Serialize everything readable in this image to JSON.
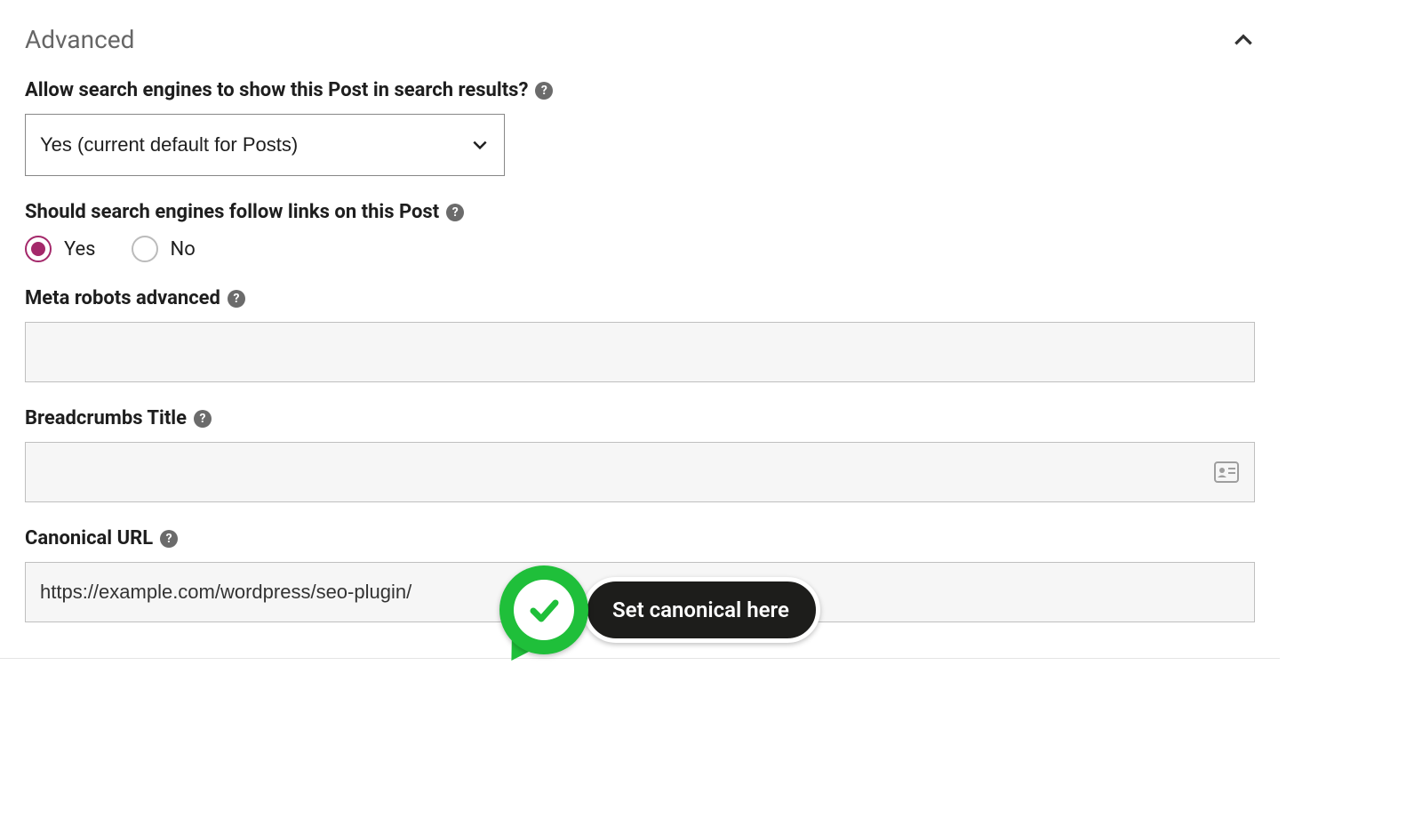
{
  "panel": {
    "title": "Advanced"
  },
  "searchResults": {
    "label": "Allow search engines to show this Post in search results?",
    "value": "Yes (current default for Posts)"
  },
  "followLinks": {
    "label": "Should search engines follow links on this Post",
    "options": {
      "yes": "Yes",
      "no": "No"
    },
    "selected": "yes"
  },
  "metaRobots": {
    "label": "Meta robots advanced",
    "value": ""
  },
  "breadcrumbs": {
    "label": "Breadcrumbs Title",
    "value": ""
  },
  "canonical": {
    "label": "Canonical URL",
    "value": "https://example.com/wordpress/seo-plugin/"
  },
  "callout": {
    "text": "Set canonical here"
  }
}
